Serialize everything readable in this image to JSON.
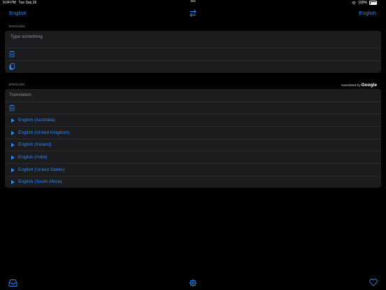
{
  "status": {
    "time": "9:04 PM",
    "date": "Tue Sep 26",
    "battery": "100%"
  },
  "nav": {
    "source_language": "English",
    "target_language": "English"
  },
  "input": {
    "section_label": "ENGLISH",
    "placeholder": "Type something"
  },
  "output": {
    "section_label": "ENGLISH",
    "attribution_prefix": "translated by",
    "attribution_brand": "Google",
    "placeholder": "Translation",
    "voices": [
      "English (Australia)",
      "English (United Kingdom)",
      "English (Ireland)",
      "English (India)",
      "English (United States)",
      "English (South Africa)"
    ]
  },
  "colors": {
    "accent": "#2f84f3",
    "background": "#000000",
    "card": "#1c1c1e"
  }
}
